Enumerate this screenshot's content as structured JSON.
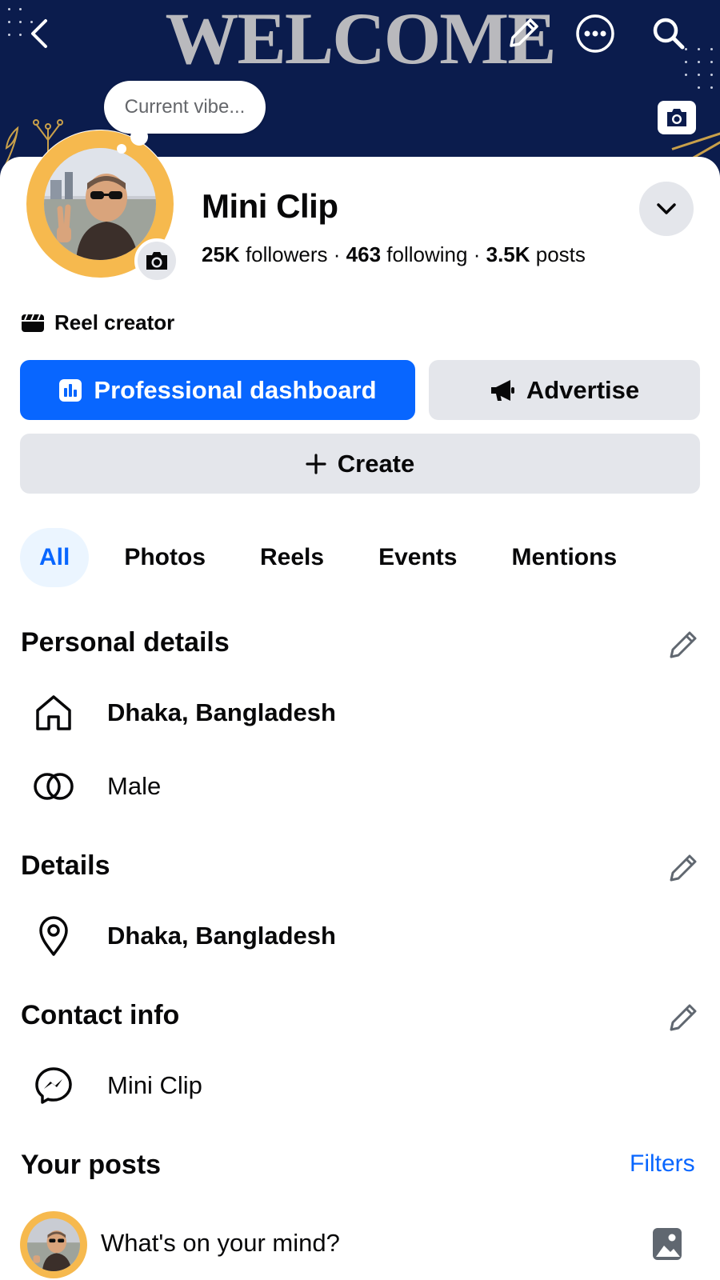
{
  "cover": {
    "word": "WELCOME",
    "background_color": "#0b1c4d",
    "icons": [
      "back-arrow-icon",
      "pencil-icon",
      "more-icon",
      "search-icon",
      "camera-icon"
    ]
  },
  "profile": {
    "status_prompt": "Current vibe...",
    "name": "Mini Clip",
    "followers_count": "25K",
    "followers_label": "followers",
    "following_count": "463",
    "following_label": "following",
    "posts_count": "3.5K",
    "posts_label": "posts",
    "separator": "·",
    "badge_label": "Reel creator",
    "ring_color": "#f6b94e"
  },
  "actions": {
    "dashboard_label": "Professional dashboard",
    "advertise_label": "Advertise",
    "create_label": "Create",
    "accent_color": "#0866ff"
  },
  "tabs": [
    {
      "label": "All",
      "active": true
    },
    {
      "label": "Photos",
      "active": false
    },
    {
      "label": "Reels",
      "active": false
    },
    {
      "label": "Events",
      "active": false
    },
    {
      "label": "Mentions",
      "active": false
    }
  ],
  "personal_details": {
    "title": "Personal details",
    "items": [
      {
        "icon": "home-icon",
        "text": "Dhaka, Bangladesh"
      },
      {
        "icon": "gender-icon",
        "text": "Male"
      }
    ]
  },
  "details": {
    "title": "Details",
    "items": [
      {
        "icon": "location-pin-icon",
        "text": "Dhaka, Bangladesh"
      }
    ]
  },
  "contact_info": {
    "title": "Contact info",
    "items": [
      {
        "icon": "messenger-icon",
        "text": "Mini Clip"
      }
    ]
  },
  "posts": {
    "title": "Your posts",
    "filters_label": "Filters",
    "composer_placeholder": "What's on your mind?"
  }
}
